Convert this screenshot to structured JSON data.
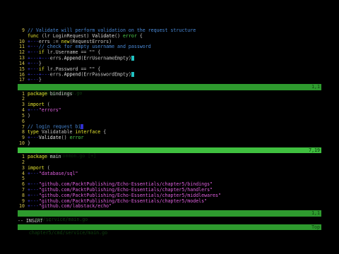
{
  "pane1": {
    "lines": [
      {
        "n": "9",
        "parts": [
          [
            "c-com",
            "// Validate will perform validation on the request structure"
          ]
        ]
      },
      {
        "n": "",
        "parts": [
          [
            "c-kw",
            "func "
          ],
          [
            "",
            "(lr LoginRequest) "
          ],
          [
            "c-fn",
            "Validate"
          ],
          [
            "",
            "() "
          ],
          [
            "c-ty",
            "error"
          ],
          [
            "",
            " {"
          ]
        ]
      },
      {
        "n": "10",
        "parts": [
          [
            "c-ws",
            "+---"
          ],
          [
            "",
            "errs := "
          ],
          [
            "c-kw",
            "new"
          ],
          [
            "",
            "(RequestErrors)"
          ]
        ]
      },
      {
        "n": "11",
        "parts": [
          [
            "c-ws",
            "+---"
          ],
          [
            "c-com",
            "// check for empty username and password"
          ]
        ]
      },
      {
        "n": "12",
        "parts": [
          [
            "c-ws",
            "+---"
          ],
          [
            "c-kw",
            "if "
          ],
          [
            "",
            "lr.Username == \"\" {"
          ]
        ]
      },
      {
        "n": "13",
        "parts": [
          [
            "c-ws",
            "+---+---"
          ],
          [
            "",
            "errs."
          ],
          [
            "c-fn",
            "Append"
          ],
          [
            "",
            "(ErrUsernameEmpty)"
          ]
        ]
      },
      {
        "n": "14",
        "parts": [
          [
            "c-ws",
            "+---"
          ],
          [
            "",
            "}"
          ]
        ]
      },
      {
        "n": "15",
        "parts": [
          [
            "c-ws",
            "+---"
          ],
          [
            "c-kw",
            "if "
          ],
          [
            "",
            "lr.Password == \"\" {"
          ]
        ]
      },
      {
        "n": "16",
        "parts": [
          [
            "c-ws",
            "+---+---"
          ],
          [
            "",
            "errs."
          ],
          [
            "c-fn",
            "Append"
          ],
          [
            "",
            "(ErrPasswordEmpty)"
          ]
        ]
      },
      {
        "n": "17",
        "parts": [
          [
            "c-ws",
            "+---"
          ],
          [
            "",
            "}"
          ]
        ]
      }
    ],
    "status_left": "bindings/login.go",
    "status_right": "1,1"
  },
  "pane2": {
    "lines": [
      {
        "n": "1",
        "parts": [
          [
            "c-kw",
            "package "
          ],
          [
            "",
            "bindings"
          ]
        ]
      },
      {
        "n": "2",
        "parts": []
      },
      {
        "n": "3",
        "parts": [
          [
            "c-kw",
            "import "
          ],
          [
            "",
            "("
          ]
        ]
      },
      {
        "n": "4",
        "parts": [
          [
            "c-ws",
            "+---"
          ],
          [
            "c-str",
            "\"errors\""
          ]
        ]
      },
      {
        "n": "5",
        "parts": [
          [
            "",
            ")"
          ]
        ]
      },
      {
        "n": "6",
        "parts": []
      },
      {
        "n": "7",
        "parts": [
          [
            "c-com",
            "// login request bi"
          ]
        ]
      },
      {
        "n": "8",
        "parts": [
          [
            "c-kw",
            "type "
          ],
          [
            "",
            "Validatable "
          ],
          [
            "c-kw",
            "interface "
          ],
          [
            "",
            "{"
          ]
        ]
      },
      {
        "n": "9",
        "parts": [
          [
            "c-ws",
            "+---"
          ],
          [
            "c-fn",
            "Validate"
          ],
          [
            "",
            "() "
          ],
          [
            "c-ty",
            "error"
          ]
        ]
      },
      {
        "n": "10",
        "parts": [
          [
            "",
            "}"
          ]
        ]
      }
    ],
    "status_left": "bindings/common.go [+]",
    "status_right": "7,19"
  },
  "pane3": {
    "lines": [
      {
        "n": "1",
        "parts": [
          [
            "c-kw",
            "package "
          ],
          [
            "",
            "main"
          ]
        ]
      },
      {
        "n": "2",
        "parts": []
      },
      {
        "n": "3",
        "parts": [
          [
            "c-kw",
            "import "
          ],
          [
            "",
            "("
          ]
        ]
      },
      {
        "n": "4",
        "parts": [
          [
            "c-ws",
            "+---"
          ],
          [
            "c-str",
            "\"database/sql\""
          ]
        ]
      },
      {
        "n": "5",
        "parts": []
      },
      {
        "n": "6",
        "parts": [
          [
            "c-ws",
            "+---"
          ],
          [
            "c-str",
            "\"github.com/PacktPublishing/Echo-Essentials/chapter5/bindings\""
          ]
        ]
      },
      {
        "n": "7",
        "parts": [
          [
            "c-ws",
            "+---"
          ],
          [
            "c-str",
            "\"github.com/PacktPublishing/Echo-Essentials/chapter5/handlers\""
          ]
        ]
      },
      {
        "n": "8",
        "parts": [
          [
            "c-ws",
            "+---"
          ],
          [
            "c-str",
            "\"github.com/PacktPublishing/Echo-Essentials/chapter5/middlewares\""
          ]
        ]
      },
      {
        "n": "9",
        "parts": [
          [
            "c-ws",
            "+---"
          ],
          [
            "c-str",
            "\"github.com/PacktPublishing/Echo-Essentials/chapter5/models\""
          ]
        ]
      },
      {
        "n": "10",
        "parts": [
          [
            "c-ws",
            "+---"
          ],
          [
            "c-str",
            "\"github.com/labstack/echo\""
          ]
        ]
      }
    ],
    "status_left": "cmd/service/main.go",
    "status_right": "1,1"
  },
  "mode": "-- INSERT --",
  "bottom_status_left": "chapter5/cmd/service/main.go",
  "bottom_status_right": "Top"
}
